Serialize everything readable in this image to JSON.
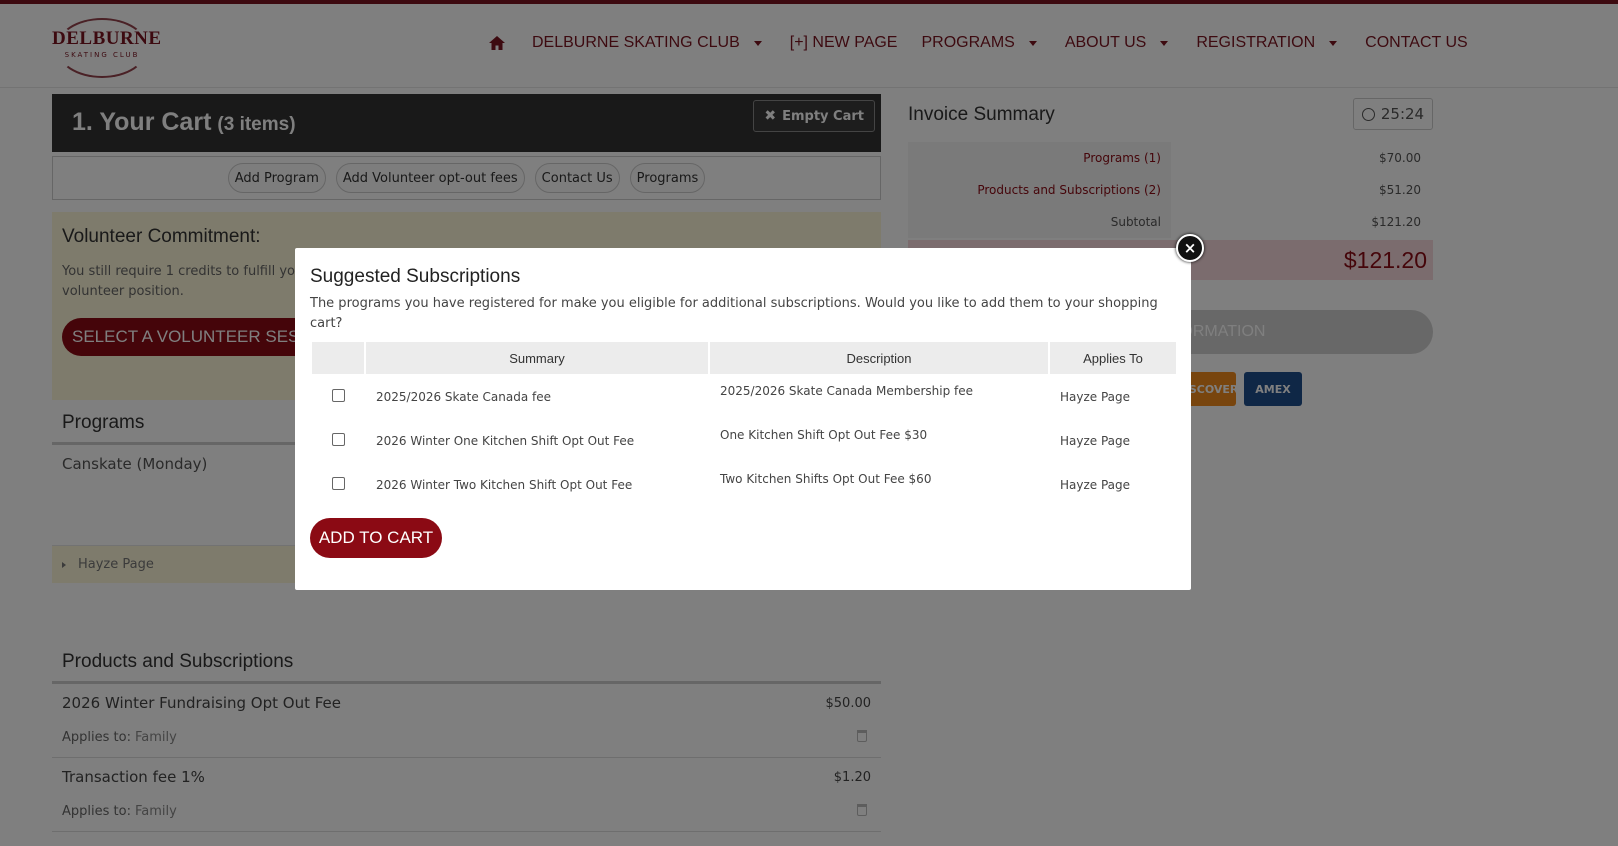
{
  "header": {
    "logo_line1": "DELBURNE",
    "logo_line2": "SKATING CLUB",
    "nav": [
      {
        "label": "DELBURNE SKATING CLUB",
        "dropdown": true
      },
      {
        "label": "[+] NEW PAGE",
        "dropdown": false
      },
      {
        "label": "PROGRAMS",
        "dropdown": true
      },
      {
        "label": "ABOUT US",
        "dropdown": true
      },
      {
        "label": "REGISTRATION",
        "dropdown": true
      },
      {
        "label": "CONTACT US",
        "dropdown": false
      }
    ]
  },
  "cart": {
    "title": "1. Your Cart",
    "count": "(3 items)",
    "empty_label": "Empty Cart",
    "tabs": [
      "Add Program",
      "Add Volunteer opt-out fees",
      "Contact Us",
      "Programs"
    ]
  },
  "volunteer": {
    "title": "Volunteer Commitment:",
    "text": "You still require 1 credits to fulfill your volunteer position.",
    "button": "SELECT A VOLUNTEER SESSION"
  },
  "programs": {
    "title": "Programs",
    "item": "Canskate (Monday)",
    "member": "Hayze Page"
  },
  "products": {
    "title": "Products and Subscriptions",
    "applies_label": "Applies to:",
    "items": [
      {
        "name": "2026 Winter Fundraising Opt Out Fee",
        "price": "$50.00",
        "applies": "Family"
      },
      {
        "name": "Transaction fee 1%",
        "price": "$1.20",
        "applies": "Family"
      }
    ]
  },
  "invoice": {
    "title": "Invoice Summary",
    "timer": "25:24",
    "rows": [
      {
        "label": "Programs (1)",
        "value": "$70.00",
        "link": true
      },
      {
        "label": "Products and Subscriptions (2)",
        "value": "$51.20",
        "link": true
      },
      {
        "label": "Subtotal",
        "value": "$121.20",
        "link": false
      }
    ],
    "total": "$121.20",
    "confirm": "CONFIRM INFORMATION",
    "cards": [
      {
        "label": "DISCOVER",
        "color": "#f08a1c"
      },
      {
        "label": "AMEX",
        "color": "#1f4e8c"
      }
    ]
  },
  "modal": {
    "title": "Suggested Subscriptions",
    "description": "The programs you have registered for make you eligible for additional subscriptions. Would you like to add them to your shopping cart?",
    "columns": [
      "",
      "Summary",
      "Description",
      "Applies To"
    ],
    "rows": [
      {
        "summary": "2025/2026 Skate Canada fee",
        "description": "2025/2026 Skate Canada Membership fee",
        "applies": "Hayze Page"
      },
      {
        "summary": "2026 Winter One Kitchen Shift Opt Out Fee",
        "description": "One Kitchen Shift Opt Out Fee $30",
        "applies": "Hayze Page"
      },
      {
        "summary": "2026 Winter Two Kitchen Shift Opt Out Fee",
        "description": "Two Kitchen Shifts Opt Out Fee $60",
        "applies": "Hayze Page"
      }
    ],
    "add_button": "ADD TO CART",
    "close_glyph": "×"
  }
}
